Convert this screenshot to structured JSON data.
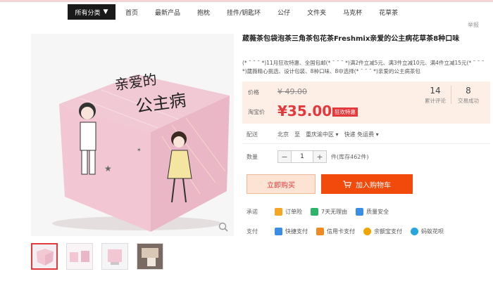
{
  "topnav": {
    "category_menu": "所有分类",
    "items": [
      "首页",
      "最新产品",
      "抱枕",
      "挂件/钥匙环",
      "公仔",
      "文件夹",
      "马克杯",
      "花草茶"
    ]
  },
  "report_label": "举报",
  "product": {
    "title": "葳薇茶包袋泡茶三角茶包花茶Freshmix亲爱的公主病花草茶8种口味",
    "subtitle": "(* ¯ ˘ ¯ *)11月狂欢特惠、全国包邮(* ¯ ˘ ¯ *)满2件立减5元、满3件立减10元、满4件立减15元(* ¯ ˘ ¯ *)葳薇精心挑选、设计包装、8种口味、8中选择(* ¯ ˘ ¯ *)亲爱的公主病茶包"
  },
  "price": {
    "label_price": "价格",
    "original": "¥ 49.00",
    "label_sale": "淘宝价",
    "sale": "¥35.00",
    "badge": "狂欢特惠"
  },
  "stats": [
    {
      "value": "14",
      "label": "累计评论"
    },
    {
      "value": "8",
      "label": "交易成功"
    }
  ],
  "shipping": {
    "label": "配送",
    "from": "北京",
    "to_word": "至",
    "destination": "重庆渝中区",
    "method": "快递 免运费"
  },
  "quantity": {
    "label": "数量",
    "minus": "−",
    "value": "1",
    "plus": "+",
    "stock": "件(库存462件)"
  },
  "buttons": {
    "buy_now": "立即购买",
    "add_cart": "加入购物车"
  },
  "promise": {
    "label": "承诺",
    "items": [
      {
        "text": "订单险",
        "color": "#f5a623"
      },
      {
        "text": "7天无理由",
        "color": "#2fb36b"
      },
      {
        "text": "质量安全",
        "color": "#3a8ee6"
      }
    ]
  },
  "payment": {
    "label": "支付",
    "items": [
      {
        "text": "快捷支付",
        "color": "#3a8ee6"
      },
      {
        "text": "信用卡支付",
        "color": "#f08a24"
      },
      {
        "text": "余额宝支付",
        "color": "#f0a500"
      },
      {
        "text": "蚂蚁花呗",
        "color": "#25a6de"
      }
    ]
  },
  "image_texts": {
    "box_line1": "亲爱的",
    "box_line2": "公主病"
  }
}
